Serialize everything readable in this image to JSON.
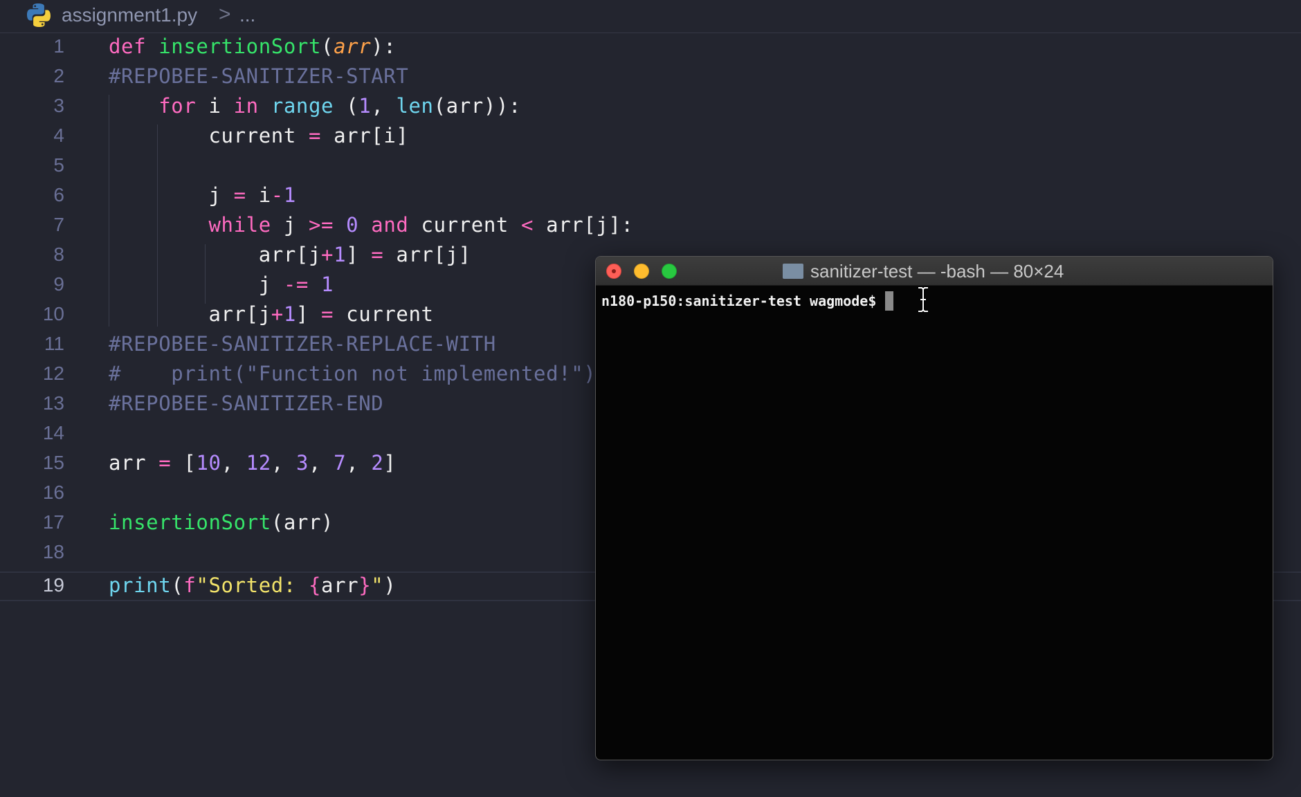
{
  "breadcrumb": {
    "file_name": "assignment1.py",
    "separator": ">",
    "more": "..."
  },
  "editor": {
    "current_line": 19,
    "line_numbers": [
      "1",
      "2",
      "3",
      "4",
      "5",
      "6",
      "7",
      "8",
      "9",
      "10",
      "11",
      "12",
      "13",
      "14",
      "15",
      "16",
      "17",
      "18",
      "19"
    ],
    "lines": [
      "def insertionSort(arr):",
      "#REPOBEE-SANITIZER-START",
      "    for i in range (1, len(arr)):",
      "        current = arr[i]",
      "",
      "        j = i-1",
      "        while j >= 0 and current < arr[j]:",
      "            arr[j+1] = arr[j]",
      "            j -= 1",
      "        arr[j+1] = current",
      "#REPOBEE-SANITIZER-REPLACE-WITH",
      "#    print(\"Function not implemented!\")",
      "#REPOBEE-SANITIZER-END",
      "",
      "arr = [10, 12, 3, 7, 2]",
      "",
      "insertionSort(arr)",
      "",
      "print(f\"Sorted: {arr}\")"
    ]
  },
  "terminal": {
    "title": "sanitizer-test — -bash — 80×24",
    "prompt": "n180-p150:sanitizer-test wagmode$ "
  },
  "colors": {
    "background": "#23252f",
    "keyword": "#ff6bc1",
    "function": "#36e46a",
    "builtin": "#6fd6ef",
    "number": "#b68cff",
    "comment": "#6a719c",
    "string": "#f2e36a",
    "parameter": "#ffa24a",
    "terminal_bg": "#050505"
  },
  "icons": [
    "python-file-icon",
    "chevron-right-icon",
    "close-window-icon",
    "minimize-window-icon",
    "maximize-window-icon",
    "folder-icon",
    "text-cursor-icon"
  ]
}
